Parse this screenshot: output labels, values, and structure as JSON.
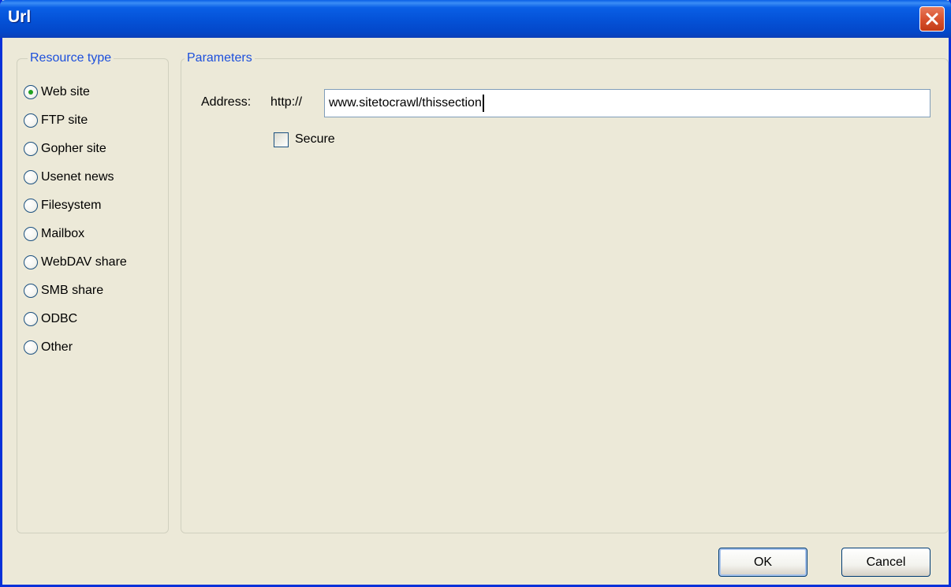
{
  "window": {
    "title": "Url"
  },
  "resource_type": {
    "legend": "Resource type",
    "selected_index": 0,
    "options": [
      {
        "label": "Web site",
        "checked": true
      },
      {
        "label": "FTP site",
        "checked": false
      },
      {
        "label": "Gopher site",
        "checked": false
      },
      {
        "label": "Usenet news",
        "checked": false
      },
      {
        "label": "Filesystem",
        "checked": false
      },
      {
        "label": "Mailbox",
        "checked": false
      },
      {
        "label": "WebDAV share",
        "checked": false
      },
      {
        "label": "SMB share",
        "checked": false
      },
      {
        "label": "ODBC",
        "checked": false
      },
      {
        "label": "Other",
        "checked": false
      }
    ]
  },
  "parameters": {
    "legend": "Parameters",
    "address_label": "Address:",
    "protocol_prefix": "http://",
    "address_value": "www.sitetocrawl/thissection",
    "secure_label": "Secure",
    "secure_checked": false
  },
  "buttons": {
    "ok": "OK",
    "cancel": "Cancel"
  },
  "colors": {
    "titlebar": "#0A5FE6",
    "legend_text": "#1C4FDC",
    "dialog_bg": "#ECE9D8",
    "close_button": "#D9532F"
  }
}
